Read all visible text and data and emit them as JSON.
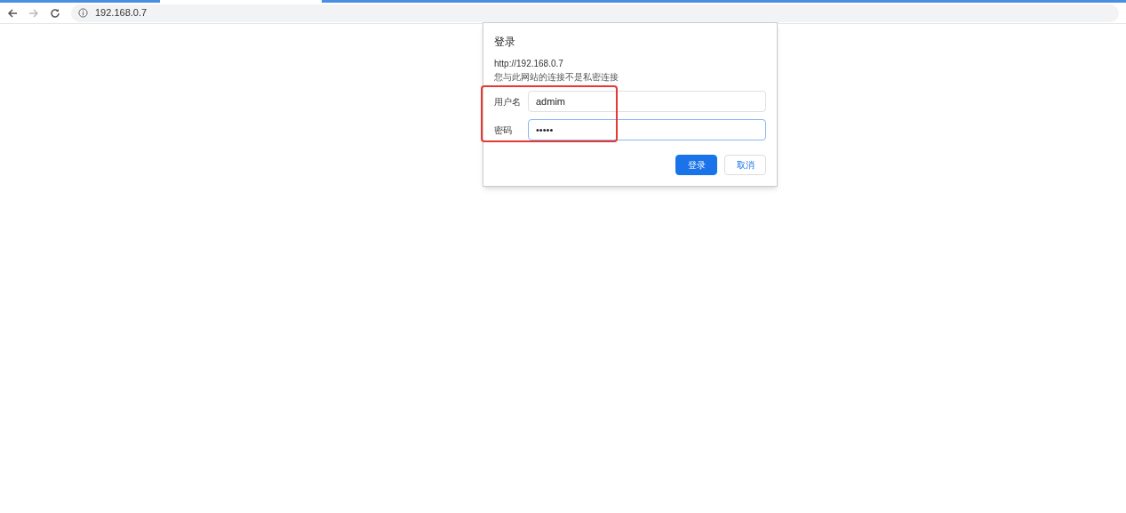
{
  "address_bar": {
    "url": "192.168.0.7"
  },
  "dialog": {
    "title": "登录",
    "origin": "http://192.168.0.7",
    "warning": "您与此网站的连接不是私密连接",
    "fields": [
      {
        "label": "用户名",
        "value": "admim",
        "focused": false
      },
      {
        "label": "密码",
        "value": "•••••",
        "focused": true
      }
    ],
    "buttons": [
      {
        "label": "登录",
        "kind": "primary"
      },
      {
        "label": "取消",
        "kind": "secondary"
      }
    ]
  }
}
